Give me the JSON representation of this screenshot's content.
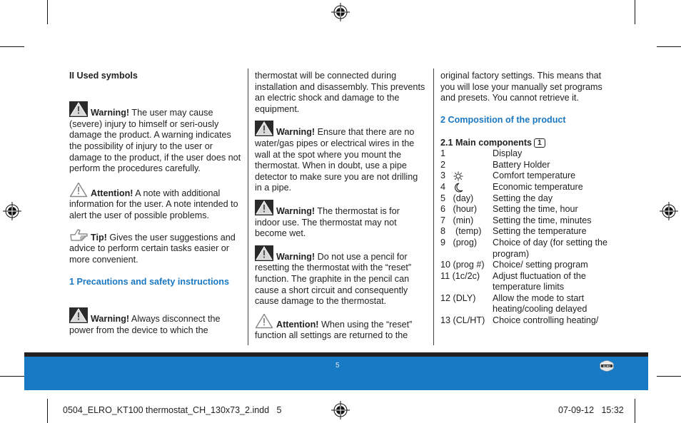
{
  "page": {
    "number": "5",
    "slug_left": "0504_ELRO_KT100 thermostat_CH_130x73_2.indd   5",
    "slug_right": "07-09-12   15:32"
  },
  "col1": {
    "heading": "II Used symbols",
    "warning1": {
      "label": "Warning!",
      "text": " The user may cause (severe) injury to himself or seri-ously damage the product. A warning indicates the possibility of injury to the user or damage to the product, if the user does not perform the procedures carefully."
    },
    "attention1": {
      "label": "Attention!",
      "text": " A note with additional information for the user. A note intended to alert the user of possible problems."
    },
    "tip": {
      "label": "Tip!",
      "text": " Gives the user suggestions and advice to perform certain tasks easier or more convenient."
    },
    "section1_heading": "1 Precautions and safety instructions",
    "warning2": {
      "label": "Warning!",
      "text": " Always disconnect the power from the device to which the"
    }
  },
  "col2": {
    "intro": "thermostat will be connected during installation and disassembly. This prevents an electric shock and damage to the equipment.",
    "warning3": {
      "label": "Warning!",
      "text": " Ensure that there are no water/gas pipes or electrical wires in the wall at the spot where you mount the thermostat. When in doubt, use a pipe detector to make sure you are not drilling in a pipe."
    },
    "warning4": {
      "label": "Warning!",
      "text": " The thermostat is for indoor use. The thermostat may not become wet."
    },
    "warning5": {
      "label": "Warning!",
      "text": " Do not use a pencil for resetting the thermostat with the “reset” function. The graphite in the pencil can cause a short circuit and consequently cause damage to the thermostat."
    },
    "attention2": {
      "label": "Attention!",
      "text": " When using the “reset” function all settings are returned to the"
    }
  },
  "col3": {
    "intro": "original factory settings. This means that you will lose your manually set programs and presets. You cannot retrieve it.",
    "section2_heading": "2 Composition of the product",
    "subheading": "2.1 Main components",
    "figure_ref": "1",
    "components": [
      {
        "num": "1",
        "desc": "Display"
      },
      {
        "num": "2",
        "desc": "Battery Holder"
      },
      {
        "num": "3",
        "icon": "sun-icon",
        "desc": "Comfort temperature"
      },
      {
        "num": "4",
        "icon": "moon-icon",
        "desc": "Economic temperature"
      },
      {
        "num": "5   (day)",
        "desc": "Setting the day"
      },
      {
        "num": "6   (hour)",
        "desc": "Setting the time, hour"
      },
      {
        "num": "7   (min)",
        "desc": "Setting the time, minutes"
      },
      {
        "num": "8    (temp)",
        "desc": " Setting the temperature"
      },
      {
        "num": "9   (prog)",
        "desc": "Choice of day (for setting the program)"
      },
      {
        "num": "10 (prog #)",
        "desc": "Choice/ setting program"
      },
      {
        "num": "11 (1c/2c)",
        "desc": "Adjust fluctuation of the temperature limits"
      },
      {
        "num": "12 (DLY)",
        "desc": "Allow the mode to start heating/cooling delayed"
      },
      {
        "num": "13 (CL/HT)",
        "desc": "Choice controlling heating/"
      }
    ]
  },
  "colors": {
    "accent_blue": "#1879c5",
    "heading_blue": "#1a78c2",
    "band_dark": "#231f20"
  }
}
